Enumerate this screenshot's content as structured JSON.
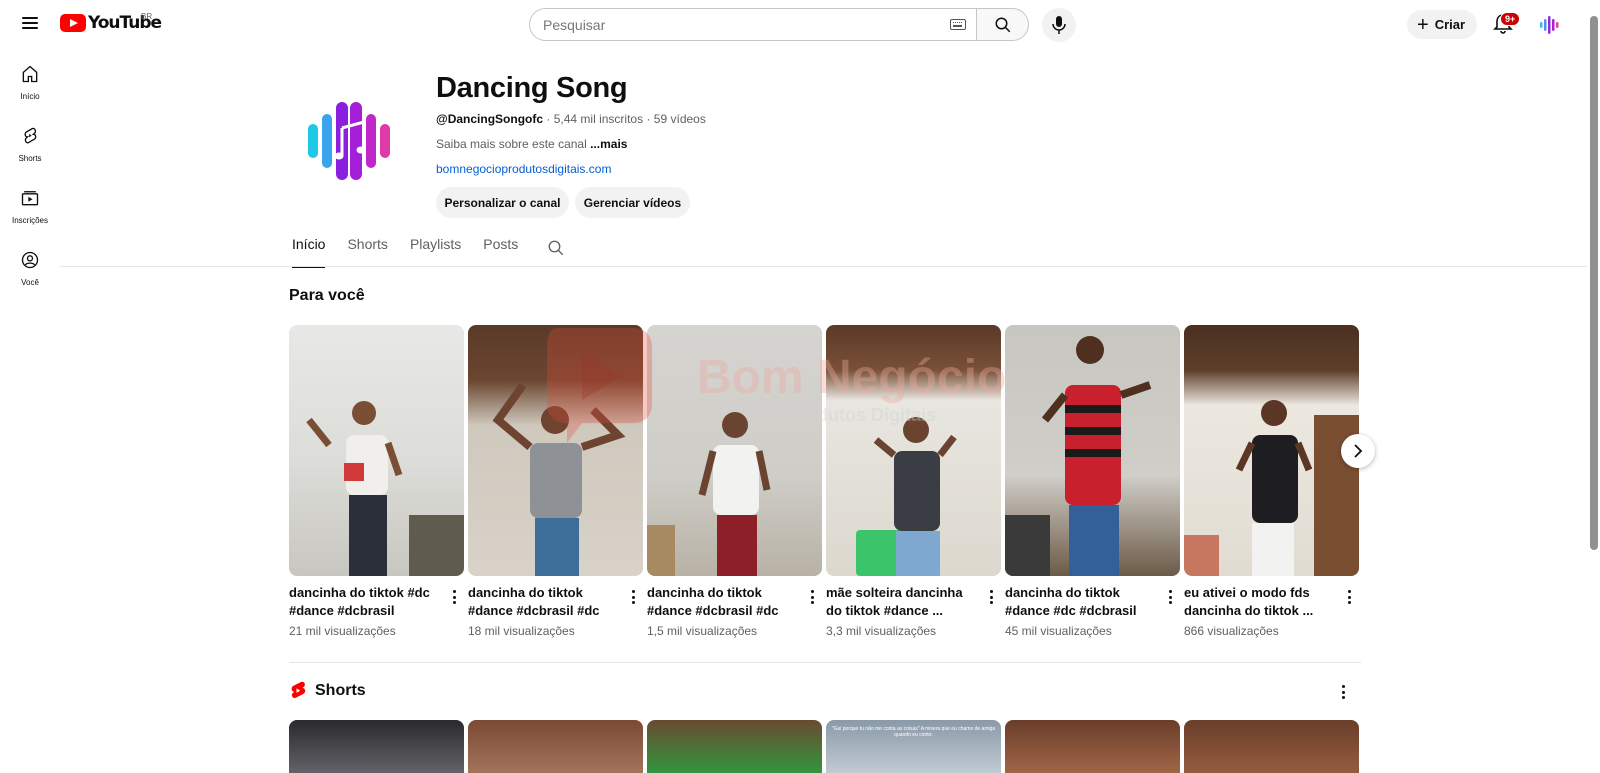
{
  "topbar": {
    "logo_text": "YouTube",
    "region": "BR",
    "search_placeholder": "Pesquisar",
    "create_label": "Criar",
    "notification_count": "9+"
  },
  "rail": {
    "items": [
      {
        "label": "Início",
        "icon": "home-icon"
      },
      {
        "label": "Shorts",
        "icon": "shorts-icon"
      },
      {
        "label": "Inscrições",
        "icon": "subscriptions-icon"
      },
      {
        "label": "Você",
        "icon": "you-icon"
      }
    ]
  },
  "channel": {
    "title": "Dancing Song",
    "handle": "@DancingSongofc",
    "subscribers": "5,44 mil inscritos",
    "video_count": "59 vídeos",
    "about": "Saiba mais sobre este canal",
    "about_more": "...mais",
    "link": "bomnegocioprodutosdigitais.com",
    "btn_customize": "Personalizar o canal",
    "btn_manage": "Gerenciar vídeos"
  },
  "tabs": [
    "Início",
    "Shorts",
    "Playlists",
    "Posts"
  ],
  "section": {
    "title": "Para você",
    "videos": [
      {
        "title": "dancinha do tiktok #dc #dance #dcbrasil",
        "views": "21 mil visualizações"
      },
      {
        "title": "dancinha do tiktok #dance #dcbrasil #dc",
        "views": "18 mil visualizações"
      },
      {
        "title": "dancinha do tiktok #dance #dcbrasil #dc",
        "views": "1,5 mil visualizações"
      },
      {
        "title": "mãe solteira dancinha do tiktok #dance ...",
        "views": "3,3 mil visualizações"
      },
      {
        "title": "dancinha do tiktok #dance #dc #dcbrasil",
        "views": "45 mil visualizações"
      },
      {
        "title": "eu ativei o modo fds dancinha do tiktok ...",
        "views": "866 visualizações"
      }
    ]
  },
  "watermark": {
    "line1": "Bom Negócio",
    "line2": "Produtos Digitais"
  },
  "shorts": {
    "title": "Shorts",
    "caption": "\"Gui porque tu não me conta as coisas\" A misera que eu chamo de amiga quando eu conto:"
  }
}
